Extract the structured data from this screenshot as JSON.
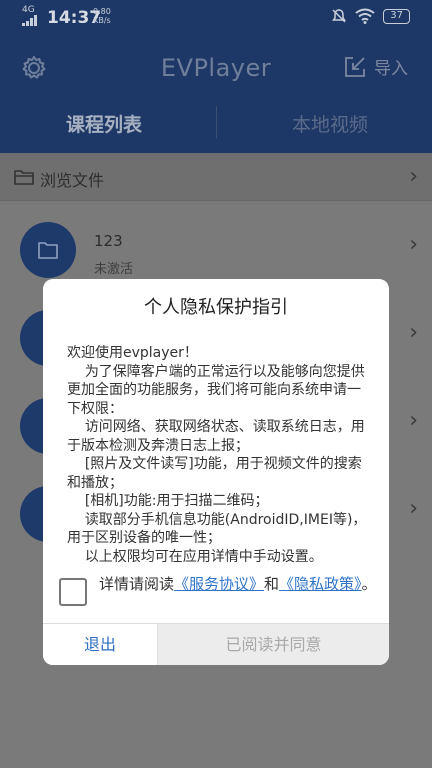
{
  "status_bar": {
    "signal": "4G",
    "time": "14:37",
    "speed_value": "0.80",
    "speed_unit": "KB/s",
    "battery": "37"
  },
  "header": {
    "app_title": "EVPlayer",
    "import_label": "导入",
    "tabs": [
      {
        "label": "课程列表",
        "active": true
      },
      {
        "label": "本地视频",
        "active": false
      }
    ]
  },
  "browse": {
    "label": "浏览文件"
  },
  "list": {
    "items": [
      {
        "name": "123",
        "status": "未激活"
      }
    ]
  },
  "dialog": {
    "title": "个人隐私保护指引",
    "body": "欢迎使用evplayer！\n    为了保障客户端的正常运行以及能够向您提供更加全面的功能服务，我们将可能向系统申请一下权限：\n    访问网络、获取网络状态、读取系统日志，用于版本检测及奔溃日志上报；\n    [照片及文件读写]功能，用于视频文件的搜索和播放；\n    [相机]功能:用于扫描二维码；\n    读取部分手机信息功能(AndroidID,IMEI等)，用于区别设备的唯一性；\n    以上权限均可在应用详情中手动设置。",
    "agree_prefix": "详情请阅读",
    "service_link": "《服务协议》",
    "and": "和",
    "privacy_link": "《隐私政策》",
    "agree_suffix": "。",
    "exit_label": "退出",
    "agree_label": "已阅读并同意"
  },
  "colors": {
    "header_bg": "#1d3866",
    "accent": "#2f74c8",
    "dim_overlay": "#7a7a7a"
  }
}
